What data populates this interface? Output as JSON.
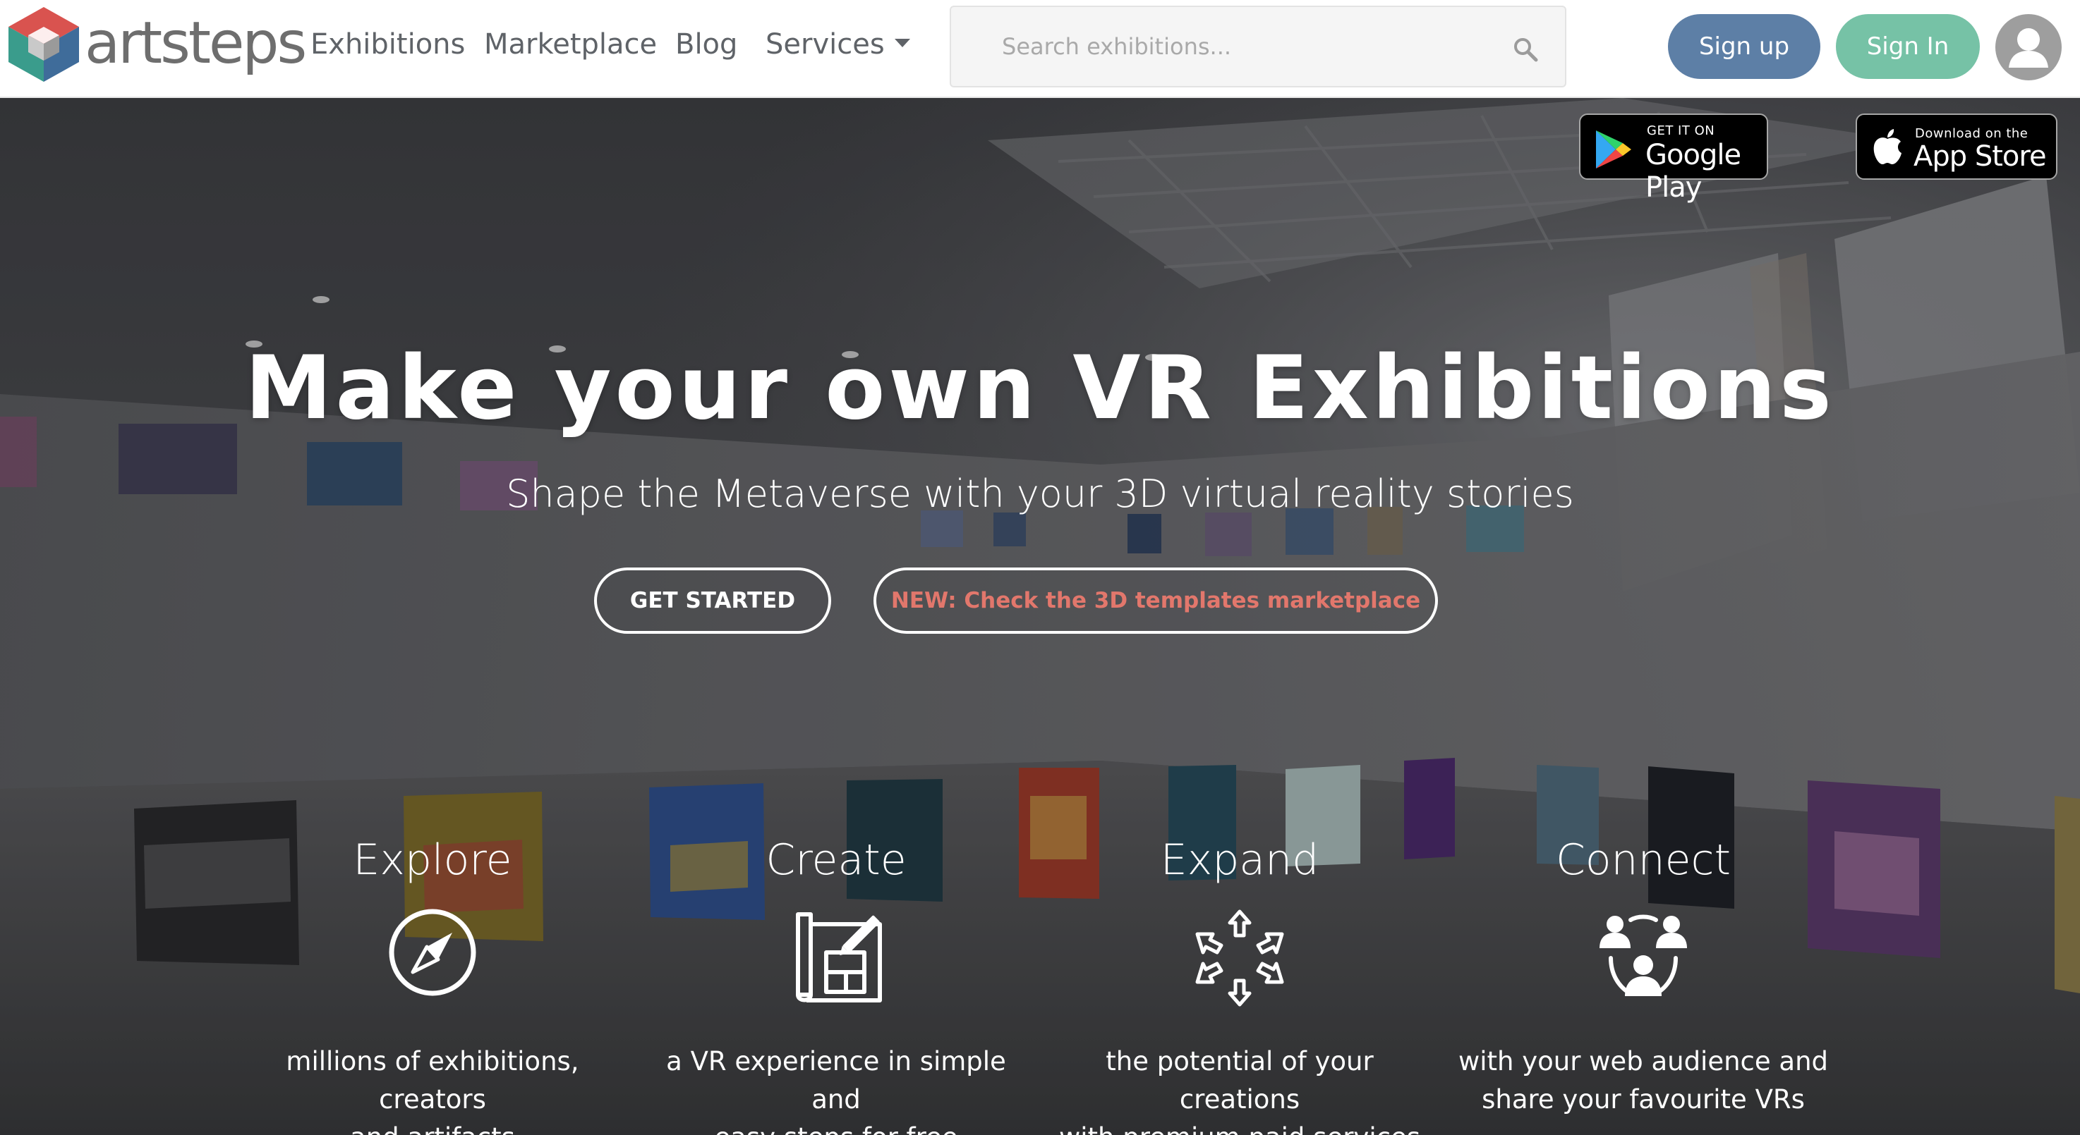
{
  "brand": {
    "name": "artsteps"
  },
  "nav": {
    "links": [
      {
        "label": "Exhibitions"
      },
      {
        "label": "Marketplace"
      },
      {
        "label": "Blog"
      },
      {
        "label": "Services"
      }
    ]
  },
  "search": {
    "placeholder": "Search exhibitions..."
  },
  "auth": {
    "signup": "Sign up",
    "signin": "Sign In"
  },
  "badges": {
    "google": {
      "small": "GET IT ON",
      "big": "Google Play"
    },
    "apple": {
      "small": "Download on the",
      "big": "App Store"
    }
  },
  "hero": {
    "title": "Make your own VR Exhibitions",
    "subtitle": "Shape the Metaverse with your 3D virtual reality stories",
    "cta_primary": "GET STARTED",
    "cta_secondary": "NEW: Check the 3D templates marketplace"
  },
  "features": [
    {
      "title": "Explore",
      "line1": "millions of exhibitions, creators",
      "line2": "and artifacts",
      "icon": "compass-icon"
    },
    {
      "title": "Create",
      "line1": "a VR experience in simple and",
      "line2": "easy steps for free",
      "icon": "blueprint-icon"
    },
    {
      "title": "Expand",
      "line1": "the potential of your creations",
      "line2": "with premium paid services",
      "icon": "expand-arrows-icon"
    },
    {
      "title": "Connect",
      "line1": "with your web audience and",
      "line2": "share your favourite VRs",
      "icon": "people-connect-icon"
    }
  ],
  "colors": {
    "signup": "#5d7fa6",
    "signin": "#76c2a6",
    "accent_red": "#e2776c",
    "logo_red": "#d9534f",
    "logo_teal": "#3a9c8c",
    "logo_blue": "#3f6c9a"
  }
}
